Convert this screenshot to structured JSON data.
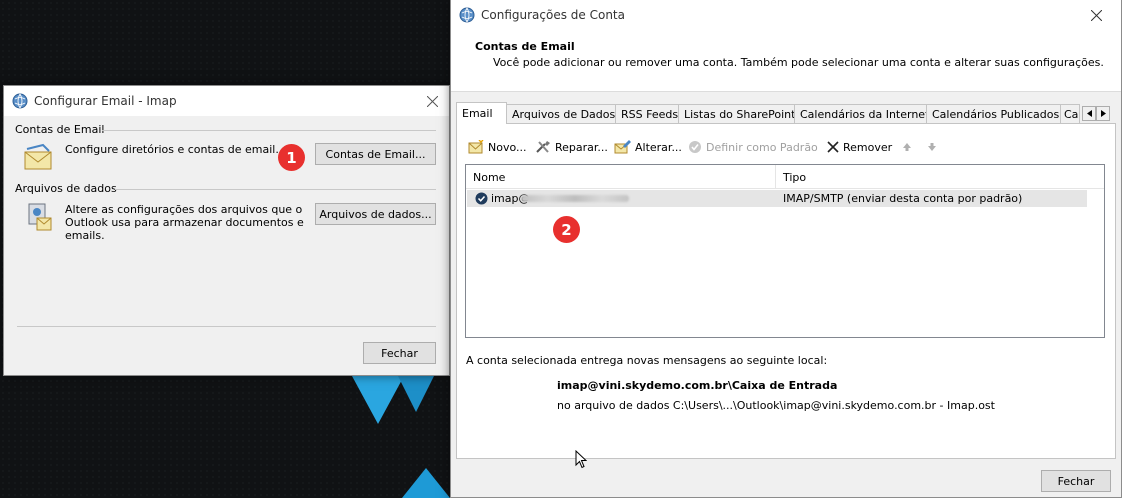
{
  "left_dialog": {
    "title": "Configurar Email - Imap",
    "section1_heading": "Contas de Email",
    "section1_text": "Configure diretórios e contas de email.",
    "section1_button": "Contas de Email...",
    "section2_heading": "Arquivos de dados",
    "section2_text_line1": "Altere as configurações dos arquivos que o",
    "section2_text_line2": "Outlook usa para armazenar documentos e",
    "section2_text_line3": "emails.",
    "section2_button": "Arquivos de dados...",
    "close_button": "Fechar"
  },
  "right_dialog": {
    "title": "Configurações de Conta",
    "header_title": "Contas de Email",
    "header_text": "Você pode adicionar ou remover uma conta. Também pode selecionar uma conta e alterar suas configurações.",
    "tabs": [
      {
        "label": "Email"
      },
      {
        "label": "Arquivos de Dados"
      },
      {
        "label": "RSS Feeds"
      },
      {
        "label": "Listas do SharePoint"
      },
      {
        "label": "Calendários da Internet"
      },
      {
        "label": "Calendários Publicados"
      },
      {
        "label": "Ca"
      }
    ],
    "toolbar": {
      "new": "Novo...",
      "repair": "Reparar...",
      "change": "Alterar...",
      "set_default": "Definir como Padrão",
      "remove": "Remover"
    },
    "list": {
      "col_name": "Nome",
      "col_type": "Tipo",
      "rows": [
        {
          "name": "imap@",
          "type": "IMAP/SMTP (enviar desta conta por padrão)"
        }
      ]
    },
    "delivery_text": "A conta selecionada entrega novas mensagens ao seguinte local:",
    "delivery_folder": "imap@vini.skydemo.com.br\\Caixa de Entrada",
    "delivery_file": "no arquivo de dados C:\\Users\\...\\Outlook\\imap@vini.skydemo.com.br - Imap.ost",
    "close_button": "Fechar"
  },
  "annotations": {
    "badge1": "1",
    "badge2": "2"
  },
  "colors": {
    "badge": "#e8302e",
    "accent_blue": "#2aa6e0"
  }
}
